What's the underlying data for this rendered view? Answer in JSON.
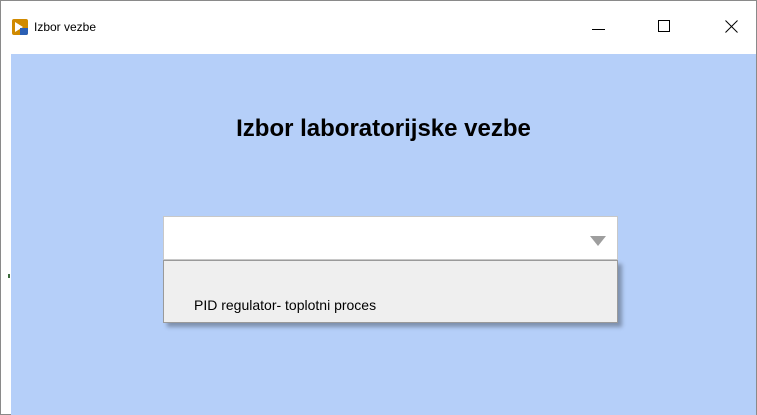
{
  "window": {
    "title": "Izbor vezbe",
    "icon": "labview-app-icon",
    "controls": [
      "minimize-icon",
      "maximize-icon",
      "close-icon"
    ]
  },
  "main": {
    "heading": "Izbor laboratorijske vezbe",
    "combo": {
      "value": "",
      "expanded": true,
      "options": [
        {
          "label": "PID regulator- toplotni proces"
        }
      ]
    }
  },
  "colors": {
    "client_background": "#b5cff9",
    "titlebar": "#ffffff",
    "dropdown_background": "#efefef"
  }
}
